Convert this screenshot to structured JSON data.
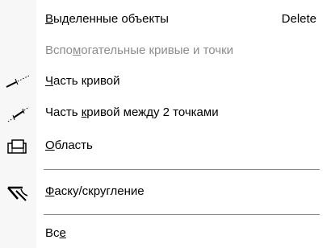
{
  "menu": {
    "items": [
      {
        "underline": "В",
        "rest": "ыделенные объекты",
        "shortcut": "Delete",
        "icon": "",
        "disabled": false
      },
      {
        "pre": "Вспо",
        "underline": "м",
        "rest": "огательные кривые и точки",
        "icon": "",
        "disabled": true
      },
      {
        "underline": "Ч",
        "rest": "асть кривой",
        "icon": "curve-part-icon",
        "disabled": false
      },
      {
        "pre": "Часть ",
        "underline": "к",
        "rest": "ривой между 2 точками",
        "icon": "curve-between-points-icon",
        "disabled": false
      },
      {
        "underline": "О",
        "rest": "бласть",
        "icon": "area-icon",
        "disabled": false
      },
      {
        "underline": "Ф",
        "rest": "аску/скругление",
        "icon": "chamfer-fillet-icon",
        "disabled": false
      },
      {
        "pre": "Вс",
        "underline": "е",
        "rest": "",
        "icon": "",
        "disabled": false
      }
    ]
  }
}
